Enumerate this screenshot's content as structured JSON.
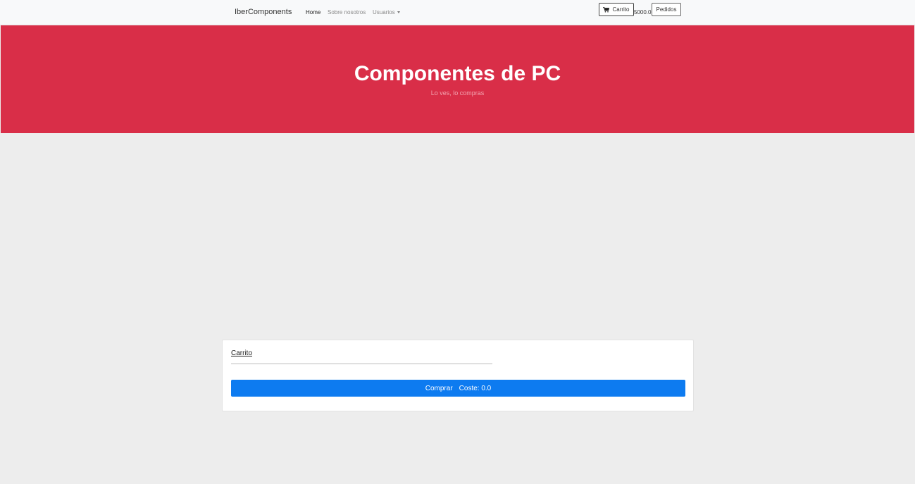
{
  "navbar": {
    "brand": "IberComponents",
    "links": [
      {
        "label": "Home",
        "active": true
      },
      {
        "label": "Sobre nosotros",
        "active": false
      },
      {
        "label": "Usuarios",
        "active": false
      }
    ],
    "cart_button": {
      "label": "Carrito",
      "icon": "cart-icon"
    },
    "balance": "5000.0",
    "orders_button": {
      "label": "Pedidos"
    }
  },
  "hero": {
    "title": "Componentes de PC",
    "subtitle": "Lo ves, lo compras",
    "background_color": "#d92e48"
  },
  "cart": {
    "title": "Carrito",
    "buy_label": "Comprar",
    "cost_label": "Coste: 0.0",
    "button_color": "#0d7bf0"
  }
}
